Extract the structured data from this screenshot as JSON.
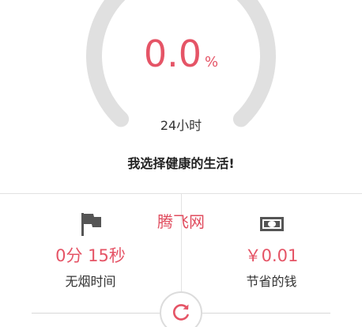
{
  "progress": {
    "value": "0.0",
    "unit": "%",
    "hours_label": "24小时"
  },
  "slogan": "我选择健康的生活!",
  "watermark": "腾飞网",
  "stats": {
    "smoke_free": {
      "value": "0分 15秒",
      "label": "无烟时间",
      "icon": "flag-icon"
    },
    "money_saved": {
      "value": "￥0.01",
      "label": "节省的钱",
      "icon": "money-icon"
    }
  },
  "reset": {
    "icon": "refresh-icon"
  },
  "colors": {
    "accent": "#e55466",
    "ring": "#e0e0e0",
    "icon": "#555555"
  }
}
